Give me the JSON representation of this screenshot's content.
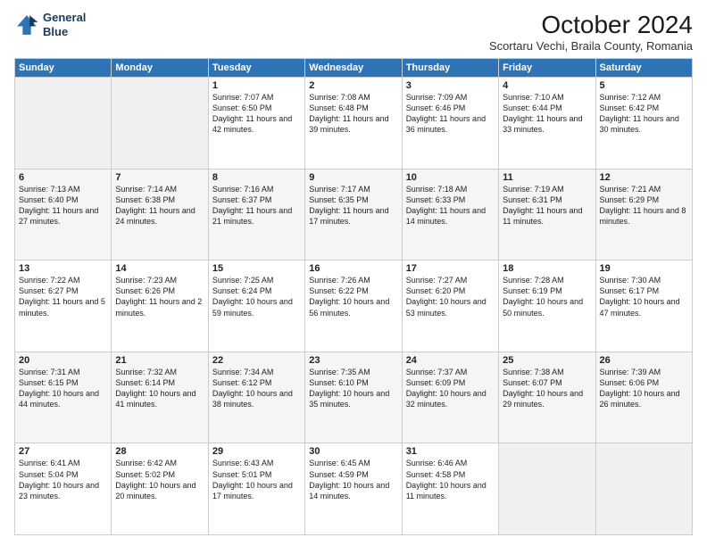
{
  "header": {
    "logo_line1": "General",
    "logo_line2": "Blue",
    "month": "October 2024",
    "location": "Scortaru Vechi, Braila County, Romania"
  },
  "weekdays": [
    "Sunday",
    "Monday",
    "Tuesday",
    "Wednesday",
    "Thursday",
    "Friday",
    "Saturday"
  ],
  "weeks": [
    [
      {
        "day": "",
        "info": ""
      },
      {
        "day": "",
        "info": ""
      },
      {
        "day": "1",
        "info": "Sunrise: 7:07 AM\nSunset: 6:50 PM\nDaylight: 11 hours and 42 minutes."
      },
      {
        "day": "2",
        "info": "Sunrise: 7:08 AM\nSunset: 6:48 PM\nDaylight: 11 hours and 39 minutes."
      },
      {
        "day": "3",
        "info": "Sunrise: 7:09 AM\nSunset: 6:46 PM\nDaylight: 11 hours and 36 minutes."
      },
      {
        "day": "4",
        "info": "Sunrise: 7:10 AM\nSunset: 6:44 PM\nDaylight: 11 hours and 33 minutes."
      },
      {
        "day": "5",
        "info": "Sunrise: 7:12 AM\nSunset: 6:42 PM\nDaylight: 11 hours and 30 minutes."
      }
    ],
    [
      {
        "day": "6",
        "info": "Sunrise: 7:13 AM\nSunset: 6:40 PM\nDaylight: 11 hours and 27 minutes."
      },
      {
        "day": "7",
        "info": "Sunrise: 7:14 AM\nSunset: 6:38 PM\nDaylight: 11 hours and 24 minutes."
      },
      {
        "day": "8",
        "info": "Sunrise: 7:16 AM\nSunset: 6:37 PM\nDaylight: 11 hours and 21 minutes."
      },
      {
        "day": "9",
        "info": "Sunrise: 7:17 AM\nSunset: 6:35 PM\nDaylight: 11 hours and 17 minutes."
      },
      {
        "day": "10",
        "info": "Sunrise: 7:18 AM\nSunset: 6:33 PM\nDaylight: 11 hours and 14 minutes."
      },
      {
        "day": "11",
        "info": "Sunrise: 7:19 AM\nSunset: 6:31 PM\nDaylight: 11 hours and 11 minutes."
      },
      {
        "day": "12",
        "info": "Sunrise: 7:21 AM\nSunset: 6:29 PM\nDaylight: 11 hours and 8 minutes."
      }
    ],
    [
      {
        "day": "13",
        "info": "Sunrise: 7:22 AM\nSunset: 6:27 PM\nDaylight: 11 hours and 5 minutes."
      },
      {
        "day": "14",
        "info": "Sunrise: 7:23 AM\nSunset: 6:26 PM\nDaylight: 11 hours and 2 minutes."
      },
      {
        "day": "15",
        "info": "Sunrise: 7:25 AM\nSunset: 6:24 PM\nDaylight: 10 hours and 59 minutes."
      },
      {
        "day": "16",
        "info": "Sunrise: 7:26 AM\nSunset: 6:22 PM\nDaylight: 10 hours and 56 minutes."
      },
      {
        "day": "17",
        "info": "Sunrise: 7:27 AM\nSunset: 6:20 PM\nDaylight: 10 hours and 53 minutes."
      },
      {
        "day": "18",
        "info": "Sunrise: 7:28 AM\nSunset: 6:19 PM\nDaylight: 10 hours and 50 minutes."
      },
      {
        "day": "19",
        "info": "Sunrise: 7:30 AM\nSunset: 6:17 PM\nDaylight: 10 hours and 47 minutes."
      }
    ],
    [
      {
        "day": "20",
        "info": "Sunrise: 7:31 AM\nSunset: 6:15 PM\nDaylight: 10 hours and 44 minutes."
      },
      {
        "day": "21",
        "info": "Sunrise: 7:32 AM\nSunset: 6:14 PM\nDaylight: 10 hours and 41 minutes."
      },
      {
        "day": "22",
        "info": "Sunrise: 7:34 AM\nSunset: 6:12 PM\nDaylight: 10 hours and 38 minutes."
      },
      {
        "day": "23",
        "info": "Sunrise: 7:35 AM\nSunset: 6:10 PM\nDaylight: 10 hours and 35 minutes."
      },
      {
        "day": "24",
        "info": "Sunrise: 7:37 AM\nSunset: 6:09 PM\nDaylight: 10 hours and 32 minutes."
      },
      {
        "day": "25",
        "info": "Sunrise: 7:38 AM\nSunset: 6:07 PM\nDaylight: 10 hours and 29 minutes."
      },
      {
        "day": "26",
        "info": "Sunrise: 7:39 AM\nSunset: 6:06 PM\nDaylight: 10 hours and 26 minutes."
      }
    ],
    [
      {
        "day": "27",
        "info": "Sunrise: 6:41 AM\nSunset: 5:04 PM\nDaylight: 10 hours and 23 minutes."
      },
      {
        "day": "28",
        "info": "Sunrise: 6:42 AM\nSunset: 5:02 PM\nDaylight: 10 hours and 20 minutes."
      },
      {
        "day": "29",
        "info": "Sunrise: 6:43 AM\nSunset: 5:01 PM\nDaylight: 10 hours and 17 minutes."
      },
      {
        "day": "30",
        "info": "Sunrise: 6:45 AM\nSunset: 4:59 PM\nDaylight: 10 hours and 14 minutes."
      },
      {
        "day": "31",
        "info": "Sunrise: 6:46 AM\nSunset: 4:58 PM\nDaylight: 10 hours and 11 minutes."
      },
      {
        "day": "",
        "info": ""
      },
      {
        "day": "",
        "info": ""
      }
    ]
  ]
}
